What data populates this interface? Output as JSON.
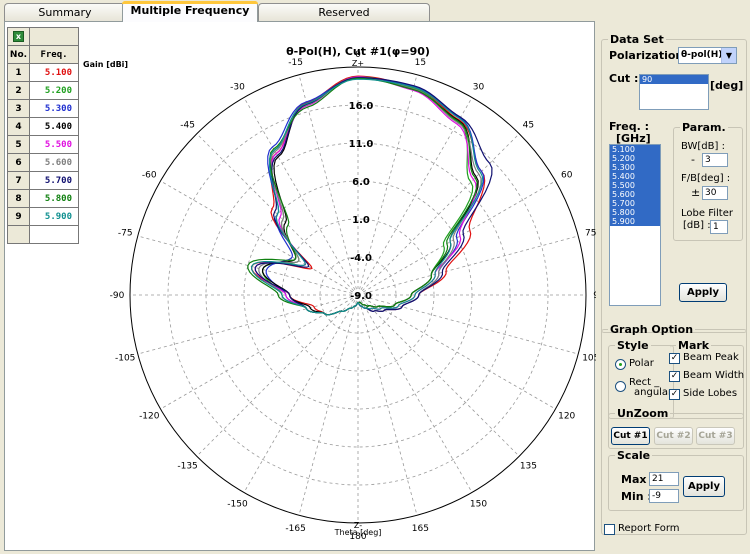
{
  "tabs": [
    {
      "label": "Summary"
    },
    {
      "label": "Multiple Frequency",
      "active": true
    },
    {
      "label": "Reserved"
    }
  ],
  "table": {
    "head_no": "No.",
    "head_freq": "Freq.",
    "rows": [
      {
        "no": "1",
        "freq": "5.100",
        "color": "#e01010"
      },
      {
        "no": "2",
        "freq": "5.200",
        "color": "#20a020"
      },
      {
        "no": "3",
        "freq": "5.300",
        "color": "#2030d0"
      },
      {
        "no": "4",
        "freq": "5.400",
        "color": "#000000"
      },
      {
        "no": "5",
        "freq": "5.500",
        "color": "#e010e0"
      },
      {
        "no": "6",
        "freq": "5.600",
        "color": "#808080"
      },
      {
        "no": "7",
        "freq": "5.700",
        "color": "#101070"
      },
      {
        "no": "8",
        "freq": "5.800",
        "color": "#108010"
      },
      {
        "no": "9",
        "freq": "5.900",
        "color": "#109090"
      }
    ]
  },
  "chart_data": {
    "type": "polar",
    "title": "θ-Pol(H), Cut #1(φ=90)",
    "ylabel": "Gain [dBi]",
    "xlabel": "Theta [deg]",
    "top_marker": "Z+",
    "bottom_marker": "Z-",
    "angle_labels": [
      "0",
      "15",
      "30",
      "45",
      "60",
      "75",
      "90",
      "105",
      "120",
      "135",
      "150",
      "165",
      "180",
      "-165",
      "-150",
      "-135",
      "-120",
      "-105",
      "-90",
      "-75",
      "-60",
      "-45",
      "-30",
      "-15"
    ],
    "radial_labels": [
      "16.0",
      "11.0",
      "6.0",
      "1.0",
      "-4.0",
      "-9.0"
    ],
    "rlim": [
      -9,
      21
    ],
    "grid": true,
    "series": [
      {
        "name": "5.100",
        "color": "#e01010",
        "gain": [
          19.8,
          19.3,
          17.6,
          14.0,
          8.0,
          3.0,
          -1.0,
          -3.0,
          -5.0,
          -6.0,
          -7.0,
          -7.5,
          -8.0,
          -7.5,
          -7.0,
          -6.0,
          -4.0,
          -3.0,
          0.0,
          5.5,
          -2.0,
          7.0,
          12.5,
          17.2
        ]
      },
      {
        "name": "5.200",
        "color": "#20a020",
        "gain": [
          19.7,
          19.2,
          17.3,
          12.0,
          4.0,
          1.0,
          -2.0,
          -4.0,
          -6.0,
          -7.0,
          -7.0,
          -7.5,
          -8.0,
          -7.5,
          -7.0,
          -6.0,
          -4.0,
          -2.0,
          1.0,
          4.0,
          0.0,
          5.0,
          13.0,
          16.9
        ]
      },
      {
        "name": "5.300",
        "color": "#2030d0",
        "gain": [
          19.5,
          19.4,
          17.9,
          14.0,
          6.0,
          2.0,
          -1.0,
          -3.0,
          -5.0,
          -6.0,
          -7.0,
          -7.5,
          -8.0,
          -7.5,
          -7.0,
          -6.0,
          -4.0,
          -2.0,
          0.5,
          3.5,
          1.0,
          6.0,
          13.5,
          17.3
        ]
      },
      {
        "name": "5.400",
        "color": "#000000",
        "gain": [
          19.6,
          19.0,
          17.5,
          13.0,
          5.0,
          1.0,
          -2.0,
          -4.0,
          -6.0,
          -7.0,
          -7.5,
          -8.0,
          -8.0,
          -7.5,
          -7.0,
          -6.0,
          -4.0,
          -2.5,
          0.0,
          4.0,
          0.5,
          4.5,
          12.0,
          17.0
        ]
      },
      {
        "name": "5.500",
        "color": "#e010e0",
        "gain": [
          19.7,
          18.9,
          17.0,
          12.5,
          6.5,
          1.5,
          -1.5,
          -3.5,
          -5.5,
          -6.5,
          -7.0,
          -7.5,
          -8.0,
          -7.5,
          -7.0,
          -6.0,
          -4.0,
          -2.0,
          0.5,
          5.0,
          -1.0,
          5.5,
          12.5,
          16.8
        ]
      },
      {
        "name": "5.600",
        "color": "#808080",
        "gain": [
          19.6,
          19.1,
          17.2,
          13.5,
          5.5,
          2.0,
          -1.0,
          -3.0,
          -5.0,
          -6.0,
          -7.0,
          -7.5,
          -8.0,
          -7.5,
          -7.0,
          -6.0,
          -4.0,
          -2.0,
          1.0,
          4.5,
          0.0,
          5.0,
          12.8,
          16.9
        ]
      },
      {
        "name": "5.700",
        "color": "#101070",
        "gain": [
          19.6,
          19.5,
          18.0,
          15.5,
          7.0,
          2.5,
          -1.0,
          -3.0,
          -5.0,
          -6.0,
          -7.0,
          -7.5,
          -8.0,
          -7.5,
          -7.0,
          -6.0,
          -4.0,
          -2.0,
          0.0,
          5.0,
          -1.5,
          6.5,
          12.2,
          17.0
        ]
      },
      {
        "name": "5.800",
        "color": "#108010",
        "gain": [
          19.5,
          19.0,
          17.4,
          12.8,
          4.5,
          1.0,
          -2.0,
          -4.0,
          -6.0,
          -7.0,
          -7.5,
          -8.0,
          -8.0,
          -7.5,
          -7.0,
          -6.0,
          -4.0,
          -2.0,
          1.5,
          6.0,
          0.5,
          4.0,
          13.2,
          16.6
        ]
      },
      {
        "name": "5.900",
        "color": "#109090",
        "gain": [
          19.4,
          19.3,
          17.8,
          13.8,
          5.0,
          1.5,
          -1.5,
          -3.5,
          -5.5,
          -6.5,
          -7.0,
          -7.5,
          -8.0,
          -7.5,
          -7.0,
          -6.0,
          -4.0,
          -2.0,
          1.0,
          5.5,
          -1.0,
          6.0,
          13.0,
          17.1
        ]
      }
    ]
  },
  "panel": {
    "dataset_legend": "Data Set",
    "polarization_label": "Polarization :",
    "polarization_value": "θ-pol(H)",
    "cut_label": "Cut :",
    "cut_item": "90",
    "cut_unit": "[deg]",
    "freq_label": "Freq. :",
    "freq_unit": "[GHz]",
    "freq_items": [
      "5.100",
      "5.200",
      "5.300",
      "5.400",
      "5.500",
      "5.600",
      "5.700",
      "5.800",
      "5.900"
    ],
    "param_legend": "Param.",
    "bw_label": "BW[dB] :",
    "bw_prefix": "-",
    "bw_value": "3",
    "fb_label": "F/B[deg] :",
    "fb_prefix": "±",
    "fb_value": "30",
    "lobe_label": "Lobe Filter",
    "lobe_unit": "[dB] :",
    "lobe_value": "1",
    "apply_label": "Apply",
    "graph_legend": "Graph Option",
    "style_legend": "Style",
    "polar_label": "Polar",
    "rect_label": "Rect _",
    "rect_label2": "angular",
    "mark_legend": "Mark",
    "beam_peak": "Beam Peak",
    "beam_width": "Beam Width",
    "side_lobes": "Side Lobes",
    "unzoom_legend": "UnZoom",
    "cut1": "Cut #1",
    "cut2": "Cut #2",
    "cut3": "Cut #3",
    "scale_legend": "Scale",
    "max_label": "Max :",
    "max_value": "21",
    "min_label": "Min :",
    "min_value": "-9",
    "scale_apply": "Apply",
    "report_label": "Report Form"
  }
}
